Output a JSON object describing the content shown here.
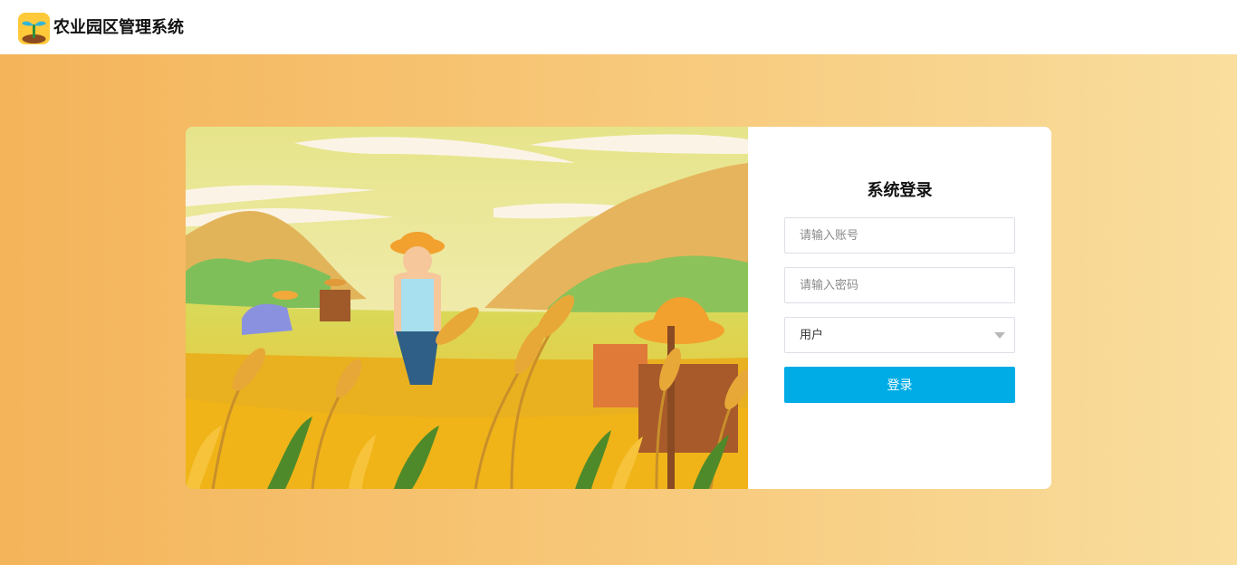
{
  "header": {
    "app_title": "农业园区管理系统",
    "logo_icon": "sprout-icon"
  },
  "login": {
    "title": "系统登录",
    "account_placeholder": "请输入账号",
    "password_placeholder": "请输入密码",
    "role_selected": "用户",
    "submit_label": "登录"
  },
  "colors": {
    "brand_yellow": "#ffc93a",
    "button_blue": "#00ace6",
    "background_orange": "#f4b45a",
    "background_light": "#f9de9e"
  },
  "illustration": {
    "subject": "farmer-in-wheat-field"
  }
}
